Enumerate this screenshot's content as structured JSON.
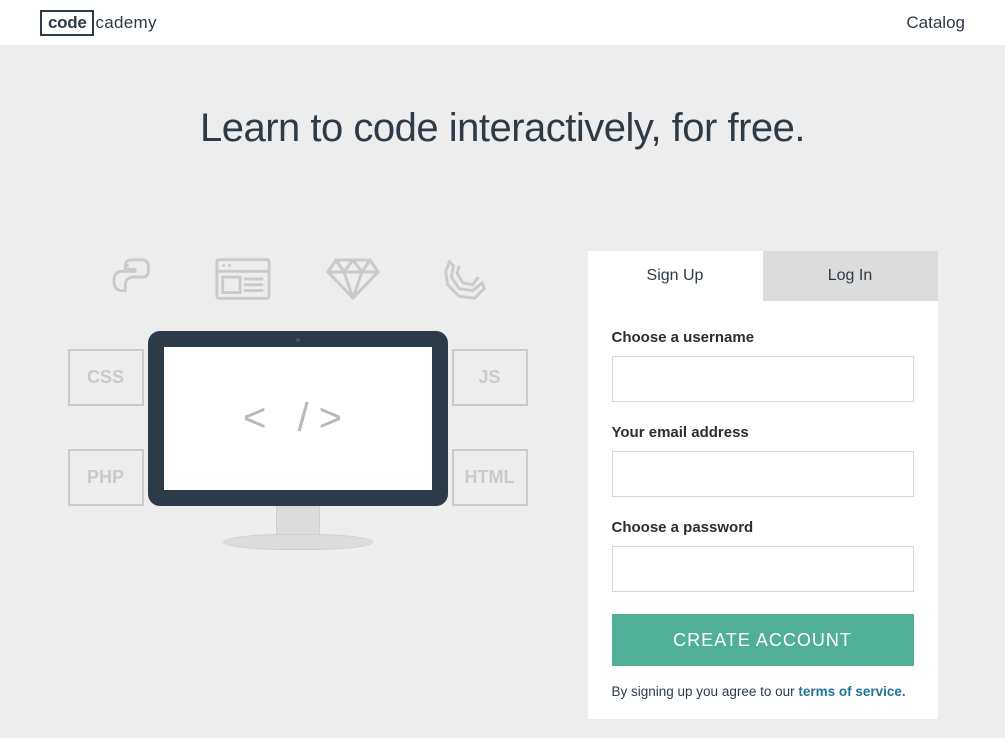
{
  "header": {
    "logo_boxed": "code",
    "logo_rest": "cademy",
    "nav_catalog": "Catalog"
  },
  "hero": {
    "title": "Learn to code interactively, for free.",
    "badges": {
      "css": "CSS",
      "js": "JS",
      "php": "PHP",
      "html": "HTML"
    },
    "screen_glyph": "< />"
  },
  "auth": {
    "tabs": {
      "signup": "Sign Up",
      "login": "Log In"
    },
    "labels": {
      "username": "Choose a username",
      "email": "Your email address",
      "password": "Choose a password"
    },
    "submit_label": "CREATE ACCOUNT",
    "terms_prefix": "By signing up you agree to our ",
    "terms_link": "terms of service."
  }
}
